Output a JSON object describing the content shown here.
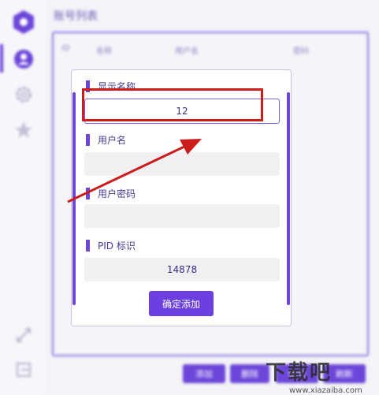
{
  "window": {
    "title": "账号列表"
  },
  "table": {
    "columns": [
      "ID",
      "名称",
      "用户名",
      "密码"
    ]
  },
  "toolbar": {
    "buttons": [
      "添加",
      "删除",
      "修改",
      "刷新"
    ]
  },
  "dialog": {
    "fields": [
      {
        "label": "显示名称",
        "value": "12"
      },
      {
        "label": "用户名",
        "value": ""
      },
      {
        "label": "用户密码",
        "value": ""
      },
      {
        "label": "PID 标识",
        "value": "14878"
      }
    ],
    "submit_label": "确定添加"
  },
  "watermark": {
    "text": "下载吧",
    "url": "www.xiazaiba.com"
  },
  "colors": {
    "accent": "#6b46d9",
    "annotation": "#cc1d1d"
  }
}
